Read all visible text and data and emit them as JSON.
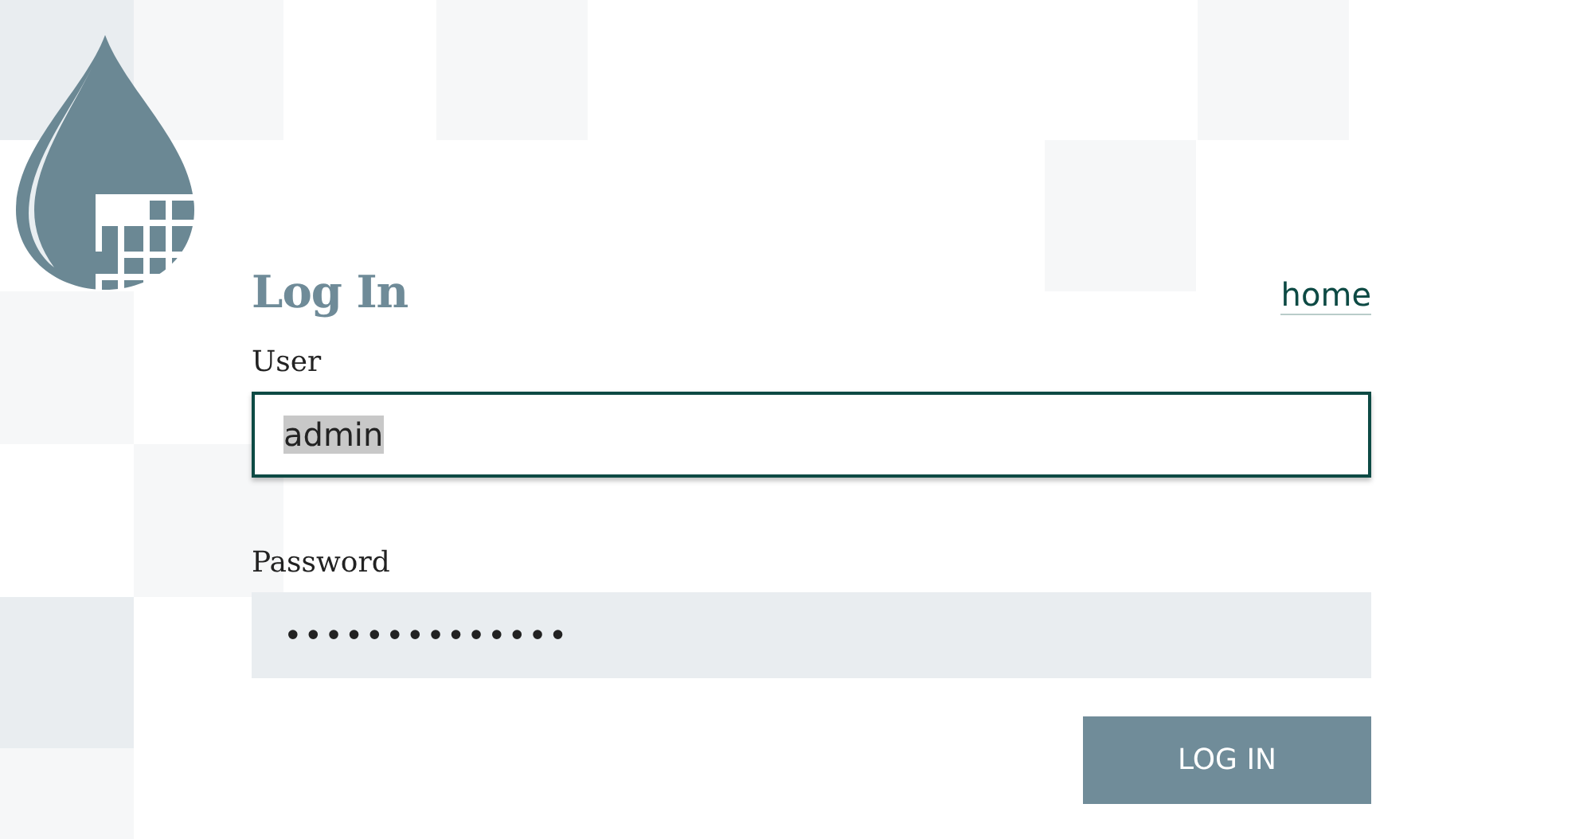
{
  "title": "Log In",
  "home_link": "home",
  "fields": [
    {
      "label": "User",
      "value": "admin",
      "kind": "text",
      "focused": true,
      "text_selected": true
    },
    {
      "label": "Password",
      "value": "••••••••••••••",
      "kind": "password",
      "focused": false,
      "text_selected": false
    }
  ],
  "button": "LOG IN"
}
